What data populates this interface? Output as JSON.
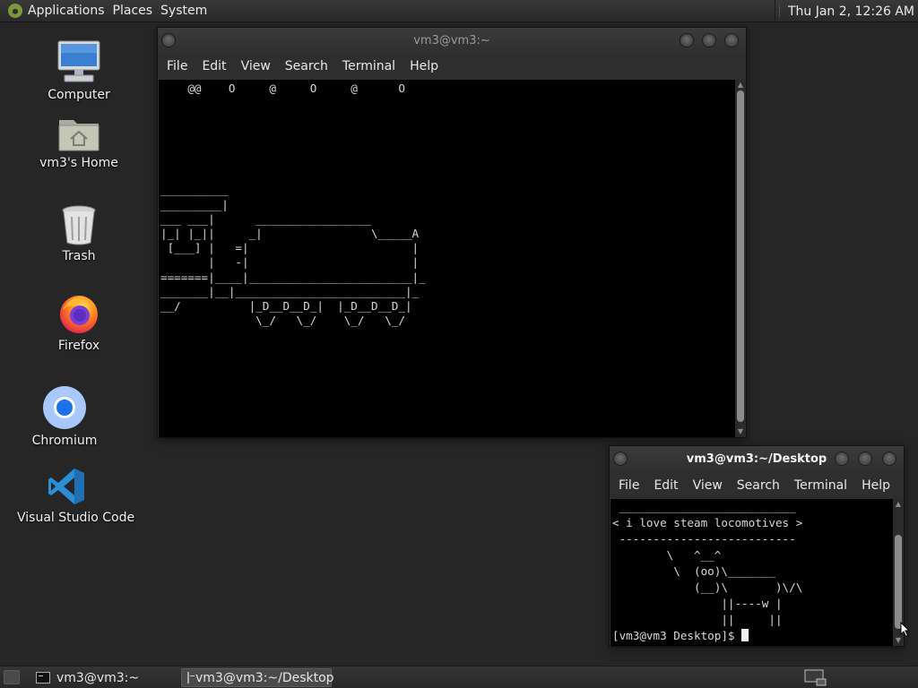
{
  "top_panel": {
    "menus": [
      "Applications",
      "Places",
      "System"
    ],
    "clock": "Thu Jan  2, 12:26 AM"
  },
  "desktop_icons": [
    {
      "label": "Computer",
      "icon": "computer-icon"
    },
    {
      "label": "vm3's Home",
      "icon": "home-folder-icon"
    },
    {
      "label": "Trash",
      "icon": "trash-icon"
    },
    {
      "label": "Firefox",
      "icon": "firefox-icon"
    },
    {
      "label": "Chromium",
      "icon": "chromium-icon"
    },
    {
      "label": "Visual Studio Code",
      "icon": "vscode-icon"
    }
  ],
  "terminal1": {
    "title": "vm3@vm3:~",
    "menu": [
      "File",
      "Edit",
      "View",
      "Search",
      "Terminal",
      "Help"
    ],
    "content": "    @@    O     @     O     @      O\n\n\n\n\n\n\n__________\n_________|\n___ ___|      _________________\n|_| |_||     _|                \\_____A\n [___] |   =|                        |\n       |   -|                        |\n=======|____|________________________|_\n_______|__|_________________________|_\n__/          |_D__D__D_|  |_D__D__D_|\n              \\_/   \\_/    \\_/   \\_/"
  },
  "terminal2": {
    "title": "vm3@vm3:~/Desktop",
    "menu": [
      "File",
      "Edit",
      "View",
      "Search",
      "Terminal",
      "Help"
    ],
    "content": " __________________________\n< i love steam locomotives >\n --------------------------\n        \\   ^__^\n         \\  (oo)\\_______\n            (__)\\       )\\/\\\n                ||----w |\n                ||     ||",
    "prompt": "[vm3@vm3 Desktop]$ "
  },
  "taskbar": {
    "tasks": [
      {
        "label": "vm3@vm3:~",
        "active": false
      },
      {
        "label": "vm3@vm3:~/Desktop",
        "active": true
      }
    ]
  }
}
